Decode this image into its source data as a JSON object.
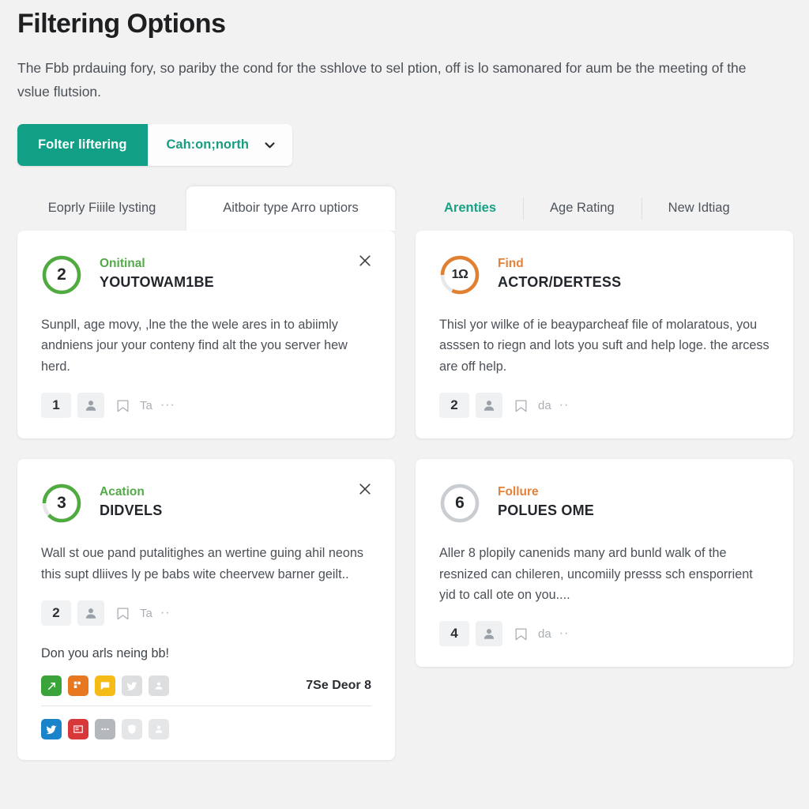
{
  "header": {
    "title": "Filtering Options",
    "description": "The Fbb prdauing fory, so pariby the cond for the sshlove to sel ption, off is lo samonared for aum be the meeting of the vslue flutsion."
  },
  "filter": {
    "button_label": "Folter liftering",
    "select_value": "Cah:on;north",
    "chevron_icon": "chevron-down-icon",
    "accent_color": "#11a085"
  },
  "tabs": {
    "left": [
      {
        "label": "Eoprly Fiiile lysting",
        "active": false
      },
      {
        "label": "Aitboir type Arro uptiors",
        "active": true
      }
    ],
    "right": [
      {
        "label": "Arenties",
        "active": true
      },
      {
        "label": "Age Rating",
        "active": false
      },
      {
        "label": "New Idtiag",
        "active": false
      }
    ]
  },
  "cards": [
    {
      "badge": {
        "number": "2",
        "ring_color": "#4faa3f",
        "ring_percent": 100
      },
      "category": {
        "text": "Onitinal",
        "color": "#54a949"
      },
      "title": "YOUTOWAM1BE",
      "body": "Sunpll, age movy, ,lne the the wele ares in to abiimly andniens jour your conteny find alt the you server hew herd.",
      "closable": true,
      "meta": {
        "count": "1",
        "label": "Ta",
        "dots": "···"
      }
    },
    {
      "badge": {
        "number": "1Ω",
        "ring_color": "#e08030",
        "ring_percent": 82
      },
      "category": {
        "text": "Find",
        "color": "#e2823b"
      },
      "title": "ACTOR/DERTESS",
      "body": "Thisl yor wilke of ie beayparcheaf file of molaratous, you asssen to riegn and lots you suft and help loge. the arcess are off help.",
      "closable": false,
      "meta": {
        "count": "2",
        "label": "da",
        "dots": "··"
      }
    },
    {
      "badge": {
        "number": "3",
        "ring_color": "#4faa3f",
        "ring_percent": 88
      },
      "category": {
        "text": "Acation",
        "color": "#54a949"
      },
      "title": "DIDVELS",
      "body": "Wall st oue pand putalitighes an wertine guing ahil neons this supt dliives ly pe babs wite cheervew barner geilt..",
      "closable": true,
      "meta": {
        "count": "2",
        "label": "Ta",
        "dots": "··"
      },
      "note": "Don you arls neing bb!",
      "social_rows": [
        {
          "count_label": "7Se Deor 8",
          "icons": [
            {
              "name": "share-icon",
              "color": "#3aa33a",
              "glyph": "share"
            },
            {
              "name": "flipboard-icon",
              "color": "#e8781f",
              "glyph": "flip"
            },
            {
              "name": "comment-icon",
              "color": "#f5bb16",
              "glyph": "comment"
            },
            {
              "name": "twitter-icon",
              "color": "#dcdee0",
              "glyph": "bird"
            },
            {
              "name": "profile-icon",
              "color": "#dcdee0",
              "glyph": "person"
            }
          ]
        },
        {
          "count_label": "",
          "icons": [
            {
              "name": "twitter-icon",
              "color": "#1b83c9",
              "glyph": "bird"
            },
            {
              "name": "news-icon",
              "color": "#d8383a",
              "glyph": "news"
            },
            {
              "name": "more-icon",
              "color": "#b4b8bc",
              "glyph": "dots"
            },
            {
              "name": "shield-icon",
              "color": "#e4e6e8",
              "glyph": "shield"
            },
            {
              "name": "profile-icon",
              "color": "#e4e6e8",
              "glyph": "person"
            }
          ]
        }
      ]
    },
    {
      "badge": {
        "number": "6",
        "ring_color": "#c9ccd0",
        "ring_percent": 100
      },
      "category": {
        "text": "Follure",
        "color": "#e2823b"
      },
      "title": "POLUES OME",
      "body": "Aller 8 plopily canenids many ard bunld walk of the resnized can chileren, uncomiily presss sch ensporrient yid to call ote on you....",
      "closable": false,
      "meta": {
        "count": "4",
        "label": "da",
        "dots": "··"
      }
    }
  ]
}
